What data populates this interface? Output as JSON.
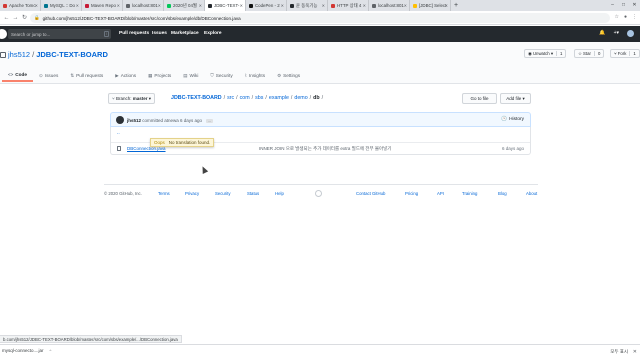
{
  "browser": {
    "tabs": [
      {
        "label": "Apache Tomc",
        "color": "#d33833"
      },
      {
        "label": "MySQL :: Do",
        "color": "#00758f"
      },
      {
        "label": "Maven Repo",
        "color": "#c71a36"
      },
      {
        "label": "localhost:801",
        "color": "#5f6368"
      },
      {
        "label": "2020년 04월",
        "color": "#03c75a"
      },
      {
        "label": "JDBC-TEXT-",
        "color": "#24292e"
      },
      {
        "label": "CodePen - 2",
        "color": "#111111"
      },
      {
        "label": "윤 동욱기능",
        "color": "#24292e"
      },
      {
        "label": "HTTP 상태 4",
        "color": "#d33833"
      },
      {
        "label": "localhost:801",
        "color": "#5f6368"
      },
      {
        "label": "[JDBC] Select",
        "color": "#ffbf00"
      }
    ],
    "url": "github.com/jhs512/JDBC-TEXT-BOARD/blob/master/src/com/sbs/example/db/DBConnection.java",
    "status_url": "b.com/jhs512/JDBC-TEXT-BOARD/blob/master/src/com/sbs/example/.../DBConnection.java"
  },
  "github": {
    "search_placeholder": "Search or jump to...",
    "search_shortcut": "/",
    "nav": [
      "Pull requests",
      "Issues",
      "Marketplace",
      "Explore"
    ],
    "owner": "jhs512",
    "repo": "JDBC-TEXT-BOARD",
    "watch": {
      "label": "Unwatch",
      "count": "1"
    },
    "star": {
      "label": "Star",
      "count": "0"
    },
    "fork": {
      "label": "Fork",
      "count": "1"
    },
    "tabs": [
      "Code",
      "Issues",
      "Pull requests",
      "Actions",
      "Projects",
      "Wiki",
      "Security",
      "Insights",
      "Settings"
    ]
  },
  "file_nav": {
    "branch_prefix": "Branch:",
    "branch": "master",
    "path_root": "JDBC-TEXT-BOARD",
    "path": [
      "src",
      "com",
      "sbs",
      "example",
      "demo"
    ],
    "path_last": "db",
    "go_to_file": "Go to file",
    "add_file": "Add file"
  },
  "commit": {
    "author": "jhs512",
    "text": "committed atnewa 6 days ago",
    "dots": "...",
    "history": "History"
  },
  "files": {
    "parent": "..",
    "rows": [
      {
        "name": "DBConnection.java",
        "message": "INNER JOIN 으로 발생되는 추가 데이터를 extra 필드에 전부 몰아넣기",
        "age": "6 days ago"
      }
    ]
  },
  "tooltip": {
    "title": "Oops",
    "text": "No translation found."
  },
  "footer": {
    "copyright": "© 2020 GitHub, Inc.",
    "left_links": [
      "Terms",
      "Privacy",
      "Security",
      "Status",
      "Help"
    ],
    "right_links": [
      "Contact GitHub",
      "Pricing",
      "API",
      "Training",
      "Blog",
      "About"
    ]
  },
  "downloads": {
    "file": "mysql-connecto....jar",
    "show_all": "모두 표시"
  }
}
